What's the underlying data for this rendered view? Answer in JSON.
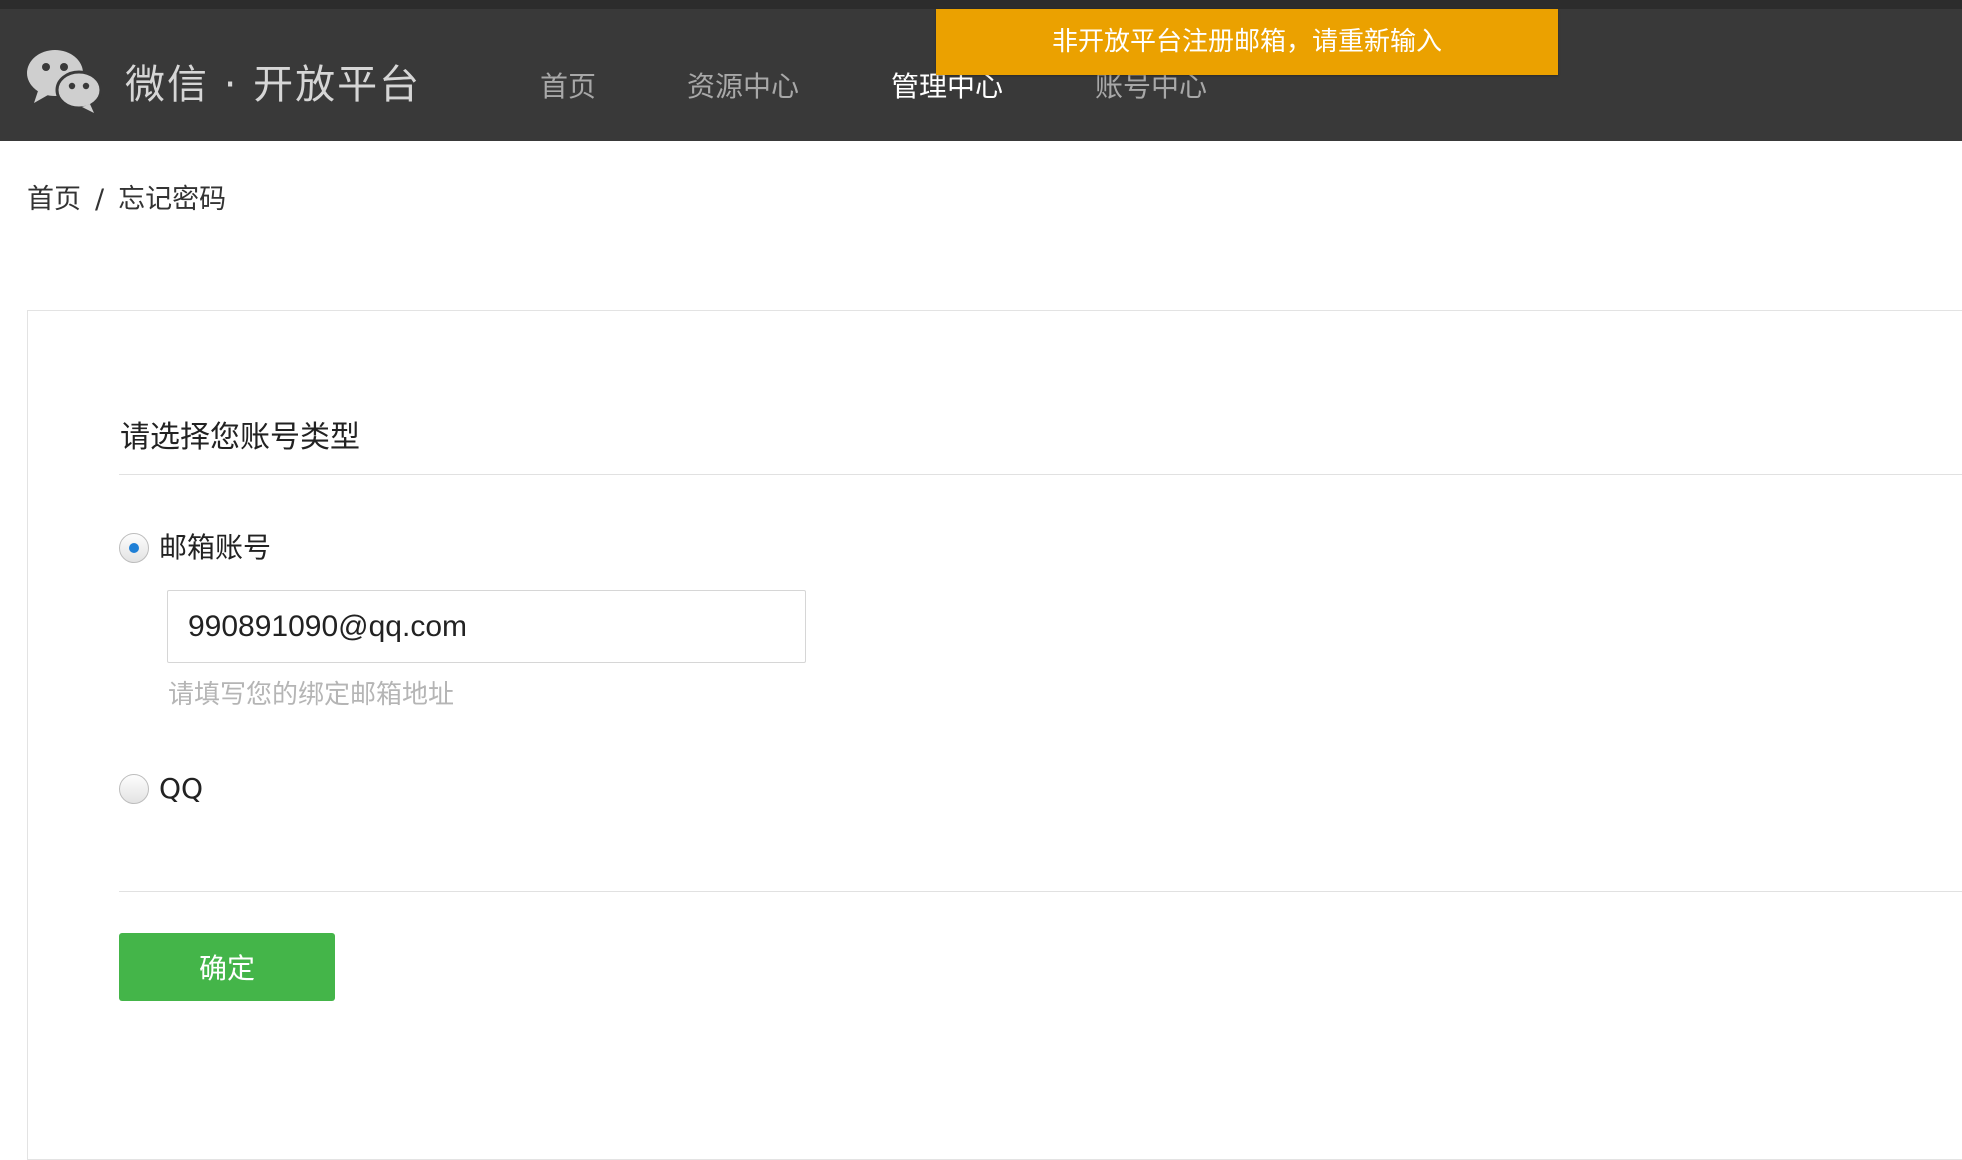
{
  "header": {
    "logo_icon": "wechat-logo-icon",
    "brand": "微信 · 开放平台",
    "nav": [
      {
        "label": "首页",
        "active": false
      },
      {
        "label": "资源中心",
        "active": false
      },
      {
        "label": "管理中心",
        "active": true
      },
      {
        "label": "账号中心",
        "active": false
      }
    ]
  },
  "toast": {
    "message": "非开放平台注册邮箱，请重新输入",
    "color": "#eba100"
  },
  "breadcrumb": {
    "home": "首页",
    "separator": "/",
    "current": "忘记密码"
  },
  "form": {
    "title": "请选择您账号类型",
    "options": [
      {
        "label": "邮箱账号",
        "checked": true
      },
      {
        "label": "QQ",
        "checked": false
      }
    ],
    "email": {
      "value": "990891090@qq.com",
      "hint": "请填写您的绑定邮箱地址"
    },
    "submit_label": "确定"
  },
  "colors": {
    "header_bg": "#393939",
    "accent_green": "#44b549",
    "radio_blue": "#1e7fd6"
  }
}
